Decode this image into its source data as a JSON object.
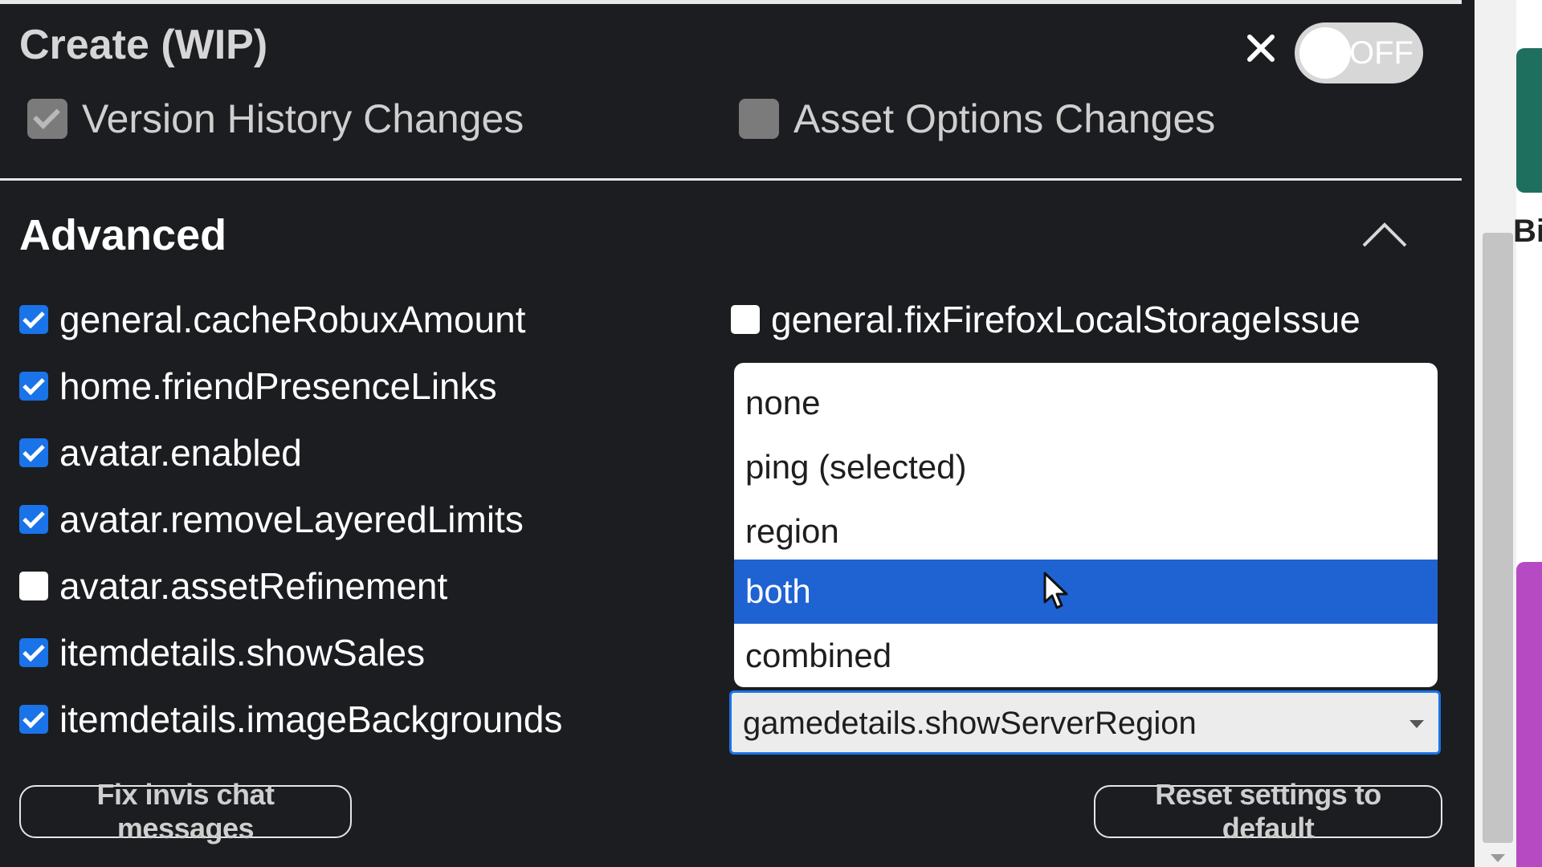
{
  "header": {
    "title": "Create (WIP)",
    "toggle_label": "OFF",
    "toggle_on": false
  },
  "features": [
    {
      "label": "Version History Changes",
      "checked": true
    },
    {
      "label": "Asset Options Changes",
      "checked": false
    }
  ],
  "advanced": {
    "title": "Advanced",
    "left_options": [
      {
        "label": "general.cacheRobuxAmount",
        "checked": true
      },
      {
        "label": "home.friendPresenceLinks",
        "checked": true
      },
      {
        "label": "avatar.enabled",
        "checked": true
      },
      {
        "label": "avatar.removeLayeredLimits",
        "checked": true
      },
      {
        "label": "avatar.assetRefinement",
        "checked": false
      },
      {
        "label": "itemdetails.showSales",
        "checked": true
      },
      {
        "label": "itemdetails.imageBackgrounds",
        "checked": true
      }
    ],
    "right_option": {
      "label": "general.fixFirefoxLocalStorageIssue",
      "checked": false
    }
  },
  "dropdown": {
    "options": [
      "none",
      "ping (selected)",
      "region",
      "both",
      "combined"
    ],
    "highlighted": "both"
  },
  "select": {
    "value": "gamedetails.showServerRegion"
  },
  "buttons": {
    "fix_chat": "Fix invis chat messages",
    "reset": "Reset settings to default"
  },
  "background_text": "Bis",
  "colors": {
    "panel_bg": "#1c1d20",
    "accent": "#1a73e8",
    "highlight": "#1f63d3"
  },
  "icons": [
    "close-icon",
    "chevron-up-icon",
    "select-arrow-icon",
    "mouse-cursor-icon",
    "scroll-down-icon"
  ]
}
